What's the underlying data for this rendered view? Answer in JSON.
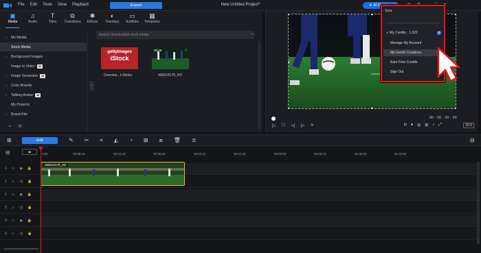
{
  "app": {
    "title": "New Untitled Project*",
    "menu": [
      "File",
      "Edit",
      "Tools",
      "View",
      "Playback"
    ],
    "export_label": "Export",
    "ai_pill": "AI Creations"
  },
  "tabs": [
    {
      "label": "Media",
      "icon": "media-icon"
    },
    {
      "label": "Audio",
      "icon": "music-note-icon"
    },
    {
      "label": "Titles",
      "icon": "titles-icon"
    },
    {
      "label": "Transitions",
      "icon": "transitions-icon"
    },
    {
      "label": "Effects",
      "icon": "effects-icon"
    },
    {
      "label": "Overlays",
      "icon": "overlays-icon"
    },
    {
      "label": "Subtitles",
      "icon": "subtitles-icon"
    },
    {
      "label": "Templates",
      "icon": "templates-icon"
    }
  ],
  "sidebar": {
    "items": [
      {
        "label": "My Media",
        "arrow": "›",
        "ai": ""
      },
      {
        "label": "Stock Media",
        "arrow": "",
        "ai": ""
      },
      {
        "label": "Background Images",
        "arrow": "›",
        "ai": ""
      },
      {
        "label": "Image to Video",
        "arrow": "",
        "ai": "AI"
      },
      {
        "label": "Image Generator",
        "arrow": "›",
        "ai": "AI"
      },
      {
        "label": "Color Boards",
        "arrow": "›",
        "ai": ""
      },
      {
        "label": "Talking Avatar",
        "arrow": "›",
        "ai": "AI"
      },
      {
        "label": "My Projects",
        "arrow": "",
        "ai": ""
      },
      {
        "label": "Brand Kits",
        "arrow": "›",
        "ai": ""
      }
    ]
  },
  "media": {
    "search_placeholder": "Search downloaded stock media",
    "items": [
      {
        "name": "Downloa...k Media",
        "brand1": "gettyimages",
        "brand2": "iStock"
      },
      {
        "name": "496818178_HD",
        "duration": "00:28"
      }
    ]
  },
  "preview": {
    "time": "00 : 00 : 00 : 00",
    "fit": "16:9"
  },
  "dropdown": {
    "user": "Sara",
    "credits": "My Credits : 1,322",
    "items": [
      "Manage My Account",
      "My GenAI Creations",
      "Earn Free Credits",
      "Sign Out"
    ]
  },
  "toolbar": {
    "edit_label": "Edit"
  },
  "timeline": {
    "ticks": [
      "0;00",
      "00:08:10",
      "00:16:20",
      "00:25:00",
      "00:33:10",
      "00:41:20",
      "00:50:00",
      "00:58:10",
      "01:06:20",
      "01:15:00"
    ],
    "clip_label": "496818178_HD",
    "tracks": [
      "1",
      "1",
      "2",
      "2",
      "3",
      "3"
    ]
  },
  "colors": {
    "accent": "#2a78e6",
    "highlight": "#e0161a",
    "clip_border": "#e6b92f"
  }
}
